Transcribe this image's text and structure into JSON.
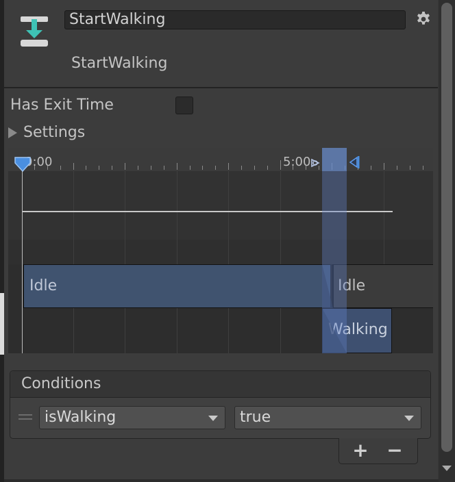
{
  "header": {
    "name_value": "StartWalking",
    "subtitle": "StartWalking",
    "asset_icon": "transition-download-icon",
    "settings_icon": "gear-icon"
  },
  "options": {
    "has_exit_time_label": "Has Exit Time",
    "has_exit_time_checked": false,
    "settings_label": "Settings"
  },
  "timeline": {
    "ruler_labels": [
      "0:00",
      "5:00"
    ],
    "clips": {
      "idle_first": "Idle",
      "idle_second": "Idle",
      "walking": "Walking"
    }
  },
  "conditions": {
    "title": "Conditions",
    "parameter": "isWalking",
    "value": "true",
    "add_label": "+",
    "remove_label": "−"
  },
  "colors": {
    "accent": "#5b7fc9",
    "clip_blue": "#40536f",
    "panel_bg": "#3c3c3c"
  }
}
